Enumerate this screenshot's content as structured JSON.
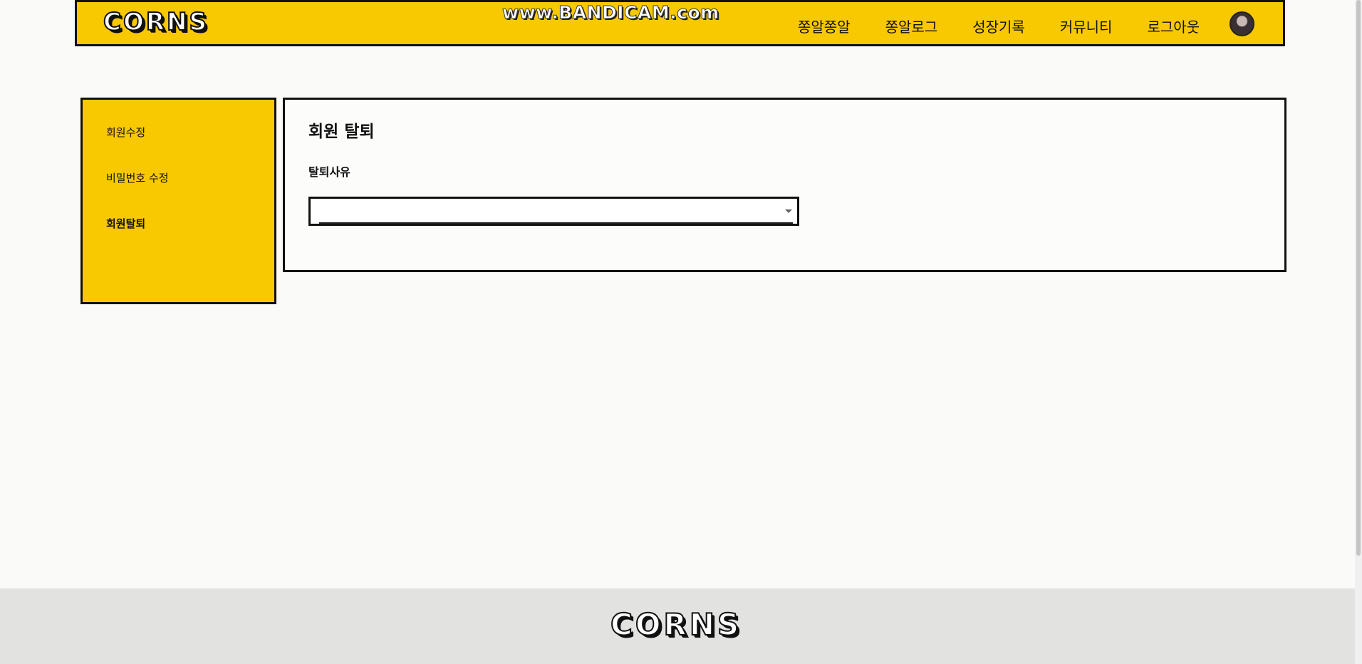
{
  "header": {
    "logo": "CORNS",
    "watermark": "www.BANDICAM.com",
    "nav": [
      "쫑알쫑알",
      "쫑알로그",
      "성장기록",
      "커뮤니티",
      "로그아웃"
    ],
    "avatar_icon": "user-avatar"
  },
  "sidebar": {
    "items": [
      {
        "label": "회원수정",
        "active": false
      },
      {
        "label": "비밀번호 수정",
        "active": false
      },
      {
        "label": "회원탈퇴",
        "active": true
      }
    ]
  },
  "main": {
    "title": "회원 탈퇴",
    "reason_label": "탈퇴사유",
    "reason_select": {
      "value": "",
      "caret_icon": "caret-down-icon"
    }
  },
  "footer": {
    "logo": "CORNS"
  },
  "colors": {
    "accent": "#f8c800",
    "border": "#111111",
    "footer_bg": "#e2e2e0",
    "page_bg": "#fafaf8"
  }
}
